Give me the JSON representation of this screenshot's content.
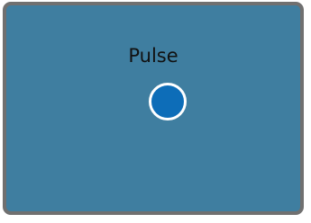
{
  "panel": {
    "title": "Pulse",
    "colors": {
      "background": "#3f7ea0",
      "border": "#707070",
      "indicator_fill": "#0d6db8",
      "indicator_outline": "#ffffff"
    }
  }
}
